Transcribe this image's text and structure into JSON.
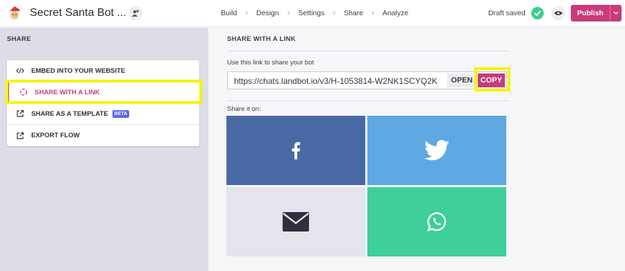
{
  "header": {
    "bot_title": "Secret Santa Bot ...",
    "nav": [
      "Build",
      "Design",
      "Settings",
      "Share",
      "Analyze"
    ],
    "nav_separator": "›",
    "draft_status": "Draft saved",
    "publish_label": "Publish"
  },
  "sidebar": {
    "heading": "SHARE",
    "items": [
      {
        "label": "EMBED INTO YOUR WEBSITE",
        "icon": "code-icon"
      },
      {
        "label": "SHARE WITH A LINK",
        "icon": "link-icon",
        "active": true
      },
      {
        "label": "SHARE AS A TEMPLATE",
        "icon": "external-link-icon",
        "badge": "BETA"
      },
      {
        "label": "EXPORT FLOW",
        "icon": "external-link-icon"
      }
    ]
  },
  "main": {
    "section_title": "SHARE WITH A LINK",
    "link_label": "Use this link to share your bot",
    "link_url": "https://chats.landbot.io/v3/H-1053814-W2NK1SCYQ2K",
    "open_label": "OPEN",
    "copy_label": "COPY",
    "share_on_label": "Share it on:",
    "tiles": [
      {
        "name": "facebook",
        "icon": "facebook-icon"
      },
      {
        "name": "twitter",
        "icon": "twitter-icon"
      },
      {
        "name": "email",
        "icon": "envelope-icon"
      },
      {
        "name": "whatsapp",
        "icon": "whatsapp-icon"
      }
    ]
  },
  "colors": {
    "brand": "#c93a7a",
    "highlight": "#f6f500",
    "facebook": "#4a6aa5",
    "twitter": "#5ea8e3",
    "email": "#e4e4ec",
    "whatsapp": "#3ecf9a",
    "success": "#3ccf91",
    "beta": "#5b65e8"
  }
}
